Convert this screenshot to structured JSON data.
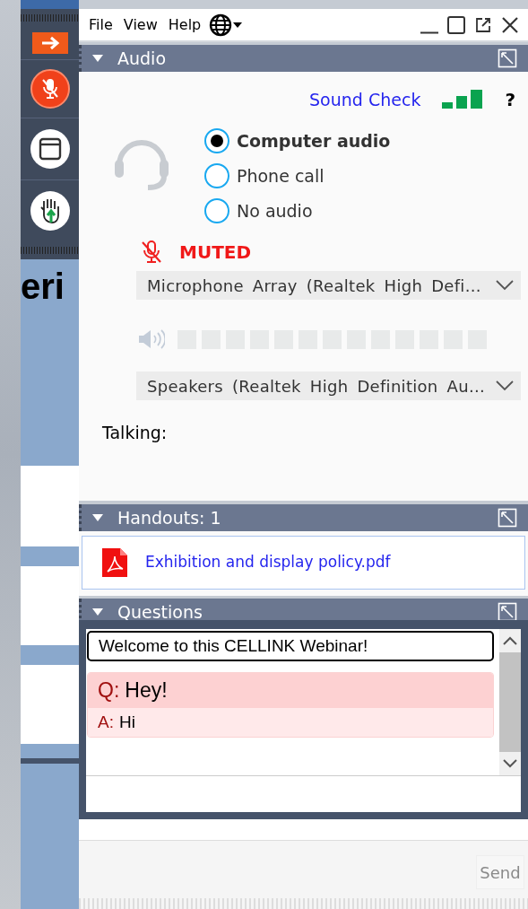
{
  "background_text": "eri",
  "menu": [
    {
      "label": "File"
    },
    {
      "label": "View"
    },
    {
      "label": "Help"
    }
  ],
  "audio": {
    "title": "Audio",
    "expanded": true,
    "sound_check": "Sound Check",
    "help": "?",
    "options": [
      {
        "label": "Computer audio",
        "selected": true
      },
      {
        "label": "Phone call",
        "selected": false
      },
      {
        "label": "No audio",
        "selected": false
      }
    ],
    "mute_status": "MUTED",
    "microphone": "Microphone Array (Realtek High Defi...",
    "speakers": "Speakers (Realtek High Definition Au...",
    "talking": "Talking:"
  },
  "handouts": {
    "title": "Handouts: 1",
    "expanded": true,
    "files": [
      {
        "name": "Exhibition and display policy.pdf"
      }
    ]
  },
  "questions": {
    "title": "Questions",
    "expanded": true,
    "welcome": "Welcome to this CELLINK Webinar!",
    "items": [
      {
        "q_label": "Q:",
        "question": "Hey!",
        "a_label": "A:",
        "answer": "Hi"
      }
    ],
    "send": {
      "label": "Send",
      "disabled": true
    }
  }
}
